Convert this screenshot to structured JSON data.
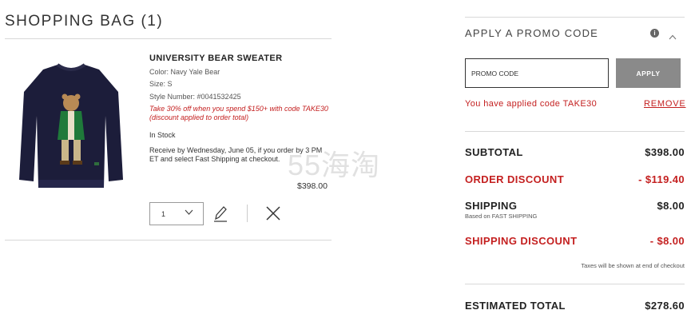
{
  "bag": {
    "title": "SHOPPING BAG (1)"
  },
  "item": {
    "name": "UNIVERSITY BEAR SWEATER",
    "color": "Color: Navy Yale Bear",
    "size": "Size: S",
    "style_number": "Style Number: #0041532425",
    "promo_note": "Take 30% off when you spend $150+ with code TAKE30 (discount applied to order total)",
    "stock": "In Stock",
    "delivery": "Receive by Wednesday, June 05, if you order by 3 PM ET and select Fast Shipping at checkout.",
    "price": "$398.00",
    "quantity": "1"
  },
  "promo": {
    "title": "APPLY A PROMO CODE",
    "info_glyph": "i",
    "placeholder": "PROMO CODE",
    "apply_label": "APPLY",
    "applied_message": "You have applied code TAKE30",
    "remove_label": "REMOVE"
  },
  "summary": {
    "subtotal_label": "SUBTOTAL",
    "subtotal_value": "$398.00",
    "discount_label": "ORDER DISCOUNT",
    "discount_value": "- $119.40",
    "shipping_label": "SHIPPING",
    "shipping_value": "$8.00",
    "shipping_sub": "Based on FAST SHIPPING",
    "ship_discount_label": "SHIPPING DISCOUNT",
    "ship_discount_value": "- $8.00",
    "taxes_note": "Taxes will be shown at end of checkout",
    "total_label": "ESTIMATED TOTAL",
    "total_value": "$278.60"
  },
  "watermark": "55海淘",
  "colors": {
    "accent_red": "#c42020",
    "apply_button": "#8a8a8a",
    "sweater_navy": "#1c1d3a"
  }
}
